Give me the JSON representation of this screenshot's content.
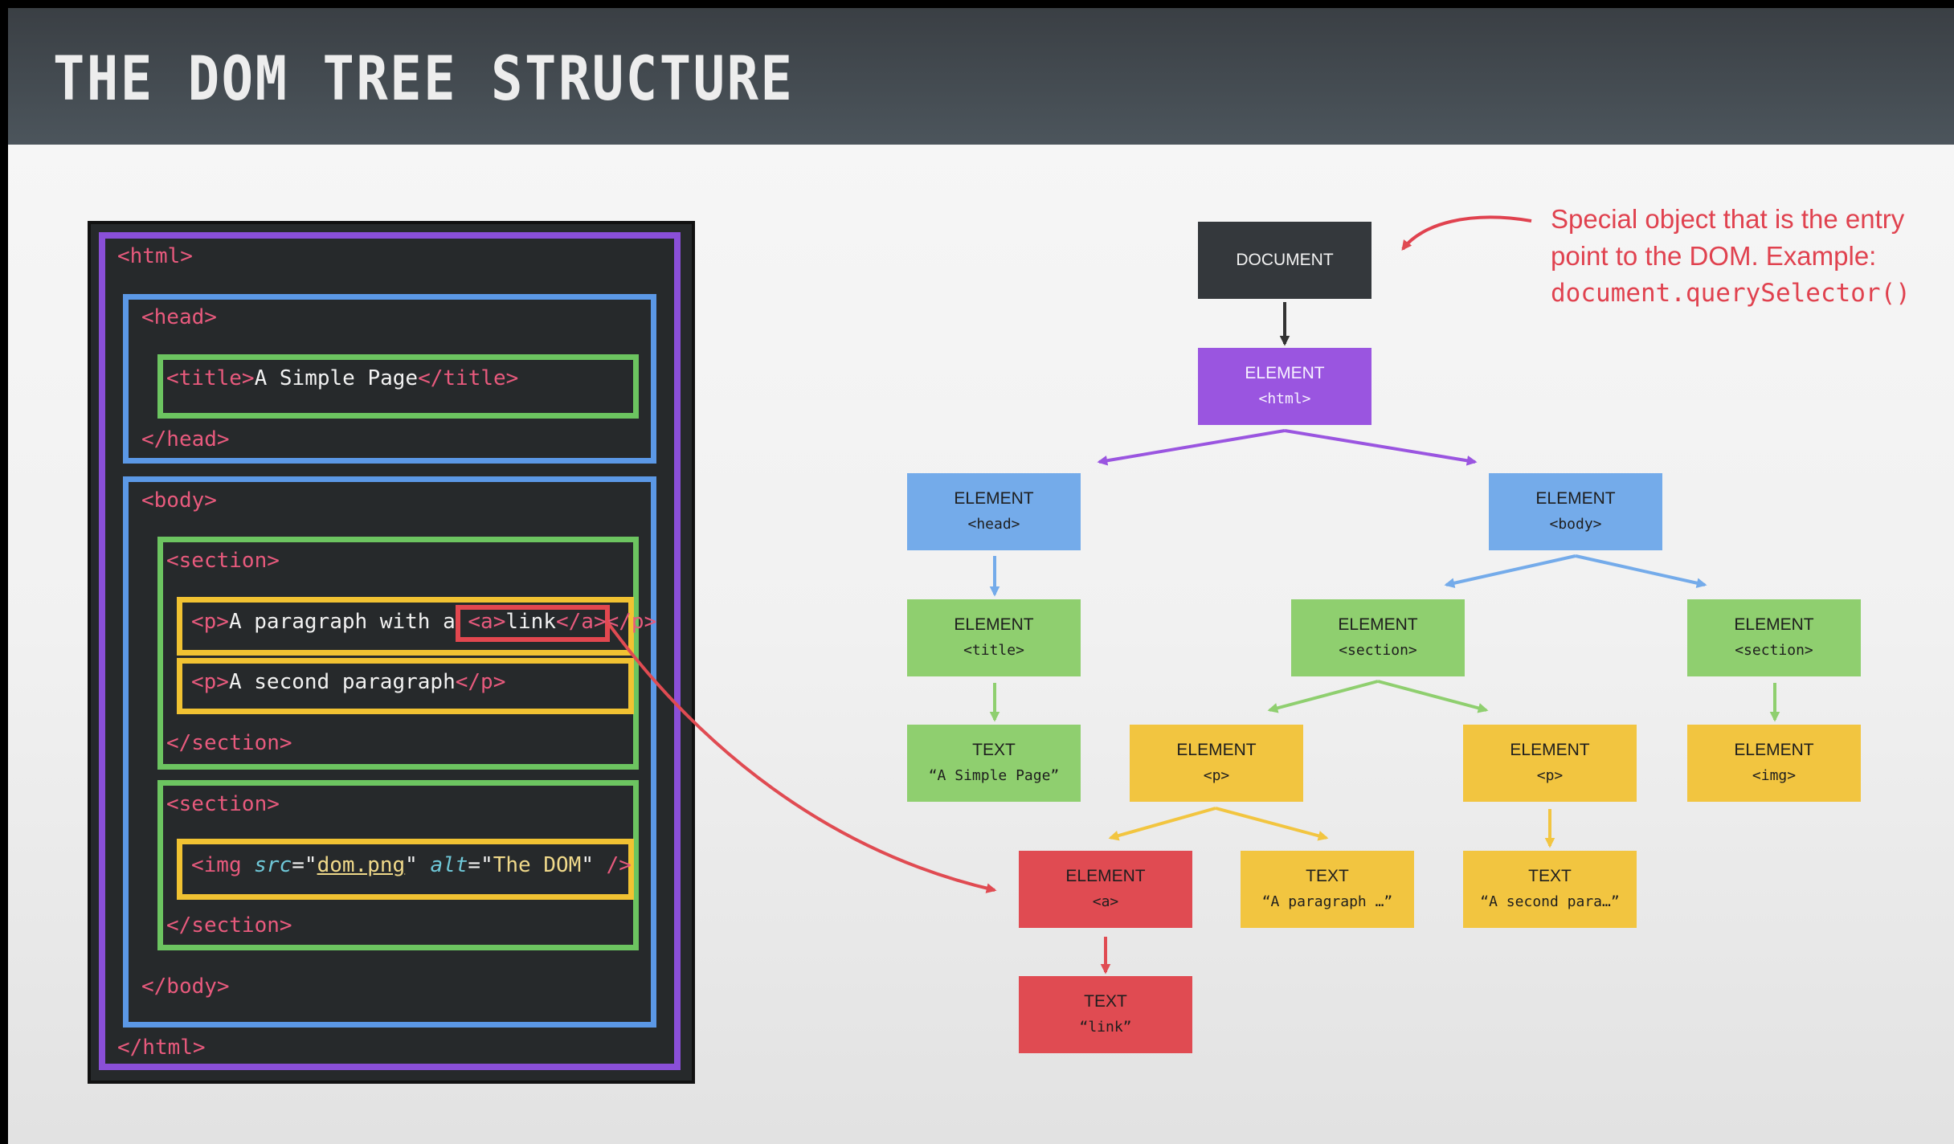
{
  "slide": {
    "title": "The DOM Tree Structure"
  },
  "code": {
    "html_open": "<html>",
    "head_open": "<head>",
    "title_open": "<title>",
    "title_text": "A Simple Page",
    "title_close": "</title>",
    "head_close": "</head>",
    "body_open": "<body>",
    "section1_open": "<section>",
    "p1_open": "<p>",
    "p1_text": "A paragraph with a ",
    "a_open": "<a>",
    "a_text": "link",
    "a_close": "</a>",
    "p1_close": "</p>",
    "p2_open": "<p>",
    "p2_text": "A second paragraph",
    "p2_close": "</p>",
    "section1_close": "</section>",
    "section2_open": "<section>",
    "img_tag": "<img",
    "img_src_attr": "src",
    "img_src_val": "dom.png",
    "img_alt_attr": "alt",
    "img_alt_val": "The DOM",
    "img_end": " />",
    "section2_close": "</section>",
    "body_close": "</body>",
    "html_close": "</html>"
  },
  "tree": {
    "document": {
      "type": "DOCUMENT",
      "sub": ""
    },
    "html": {
      "type": "ELEMENT",
      "sub": "<html>"
    },
    "head": {
      "type": "ELEMENT",
      "sub": "<head>"
    },
    "body": {
      "type": "ELEMENT",
      "sub": "<body>"
    },
    "title": {
      "type": "ELEMENT",
      "sub": "<title>"
    },
    "section1": {
      "type": "ELEMENT",
      "sub": "<section>"
    },
    "section2": {
      "type": "ELEMENT",
      "sub": "<section>"
    },
    "title_text": {
      "type": "TEXT",
      "sub": "“A Simple Page”"
    },
    "p1": {
      "type": "ELEMENT",
      "sub": "<p>"
    },
    "p2": {
      "type": "ELEMENT",
      "sub": "<p>"
    },
    "img": {
      "type": "ELEMENT",
      "sub": "<img>"
    },
    "a": {
      "type": "ELEMENT",
      "sub": "<a>"
    },
    "p1_text": {
      "type": "TEXT",
      "sub": "“A paragraph …”"
    },
    "p2_text": {
      "type": "TEXT",
      "sub": "“A second para…”"
    },
    "a_text": {
      "type": "TEXT",
      "sub": "“link”"
    }
  },
  "note": {
    "text": "Special object that is the entry point to the DOM. Example:",
    "code": "document.querySelector()"
  },
  "colors": {
    "document": "#34383c",
    "html": "#9a55e0",
    "head_body": "#74abea",
    "section_title": "#8fcf6f",
    "paragraph": "#f2c540",
    "link": "#e04b52",
    "annotation": "#e0424f"
  }
}
